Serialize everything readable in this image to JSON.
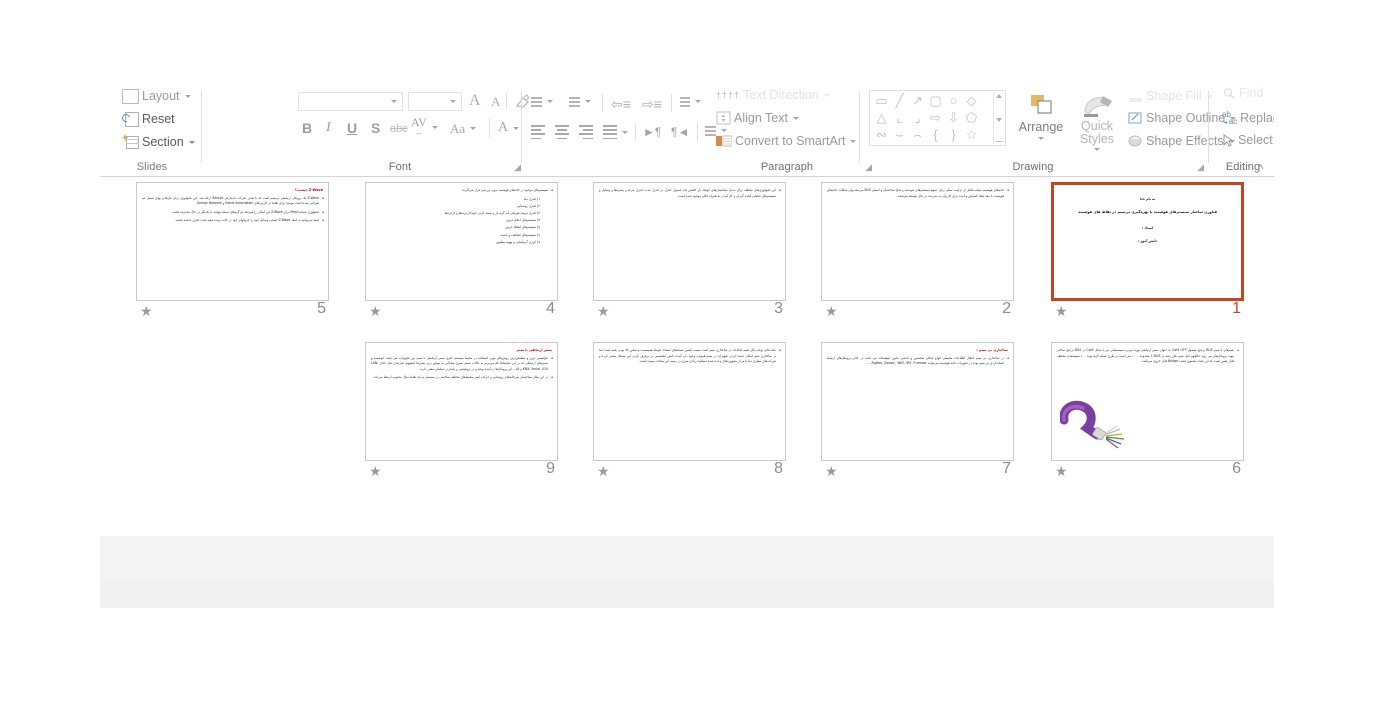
{
  "app": {
    "name": "Microsoft PowerPoint",
    "view": "Slide Sorter"
  },
  "ribbon": {
    "groups": [
      {
        "id": "slides",
        "label": "Slides"
      },
      {
        "id": "font",
        "label": "Font"
      },
      {
        "id": "paragraph",
        "label": "Paragraph"
      },
      {
        "id": "drawing",
        "label": "Drawing"
      },
      {
        "id": "editing",
        "label": "Editing"
      }
    ],
    "slides_group": {
      "label": "Slides",
      "layout_label": "Layout",
      "reset_label": "Reset",
      "section_label": "Section"
    },
    "font_group": {
      "label": "Font",
      "font_name_value": "",
      "font_size_value": "",
      "grow_font": "A",
      "shrink_font": "A",
      "clear_formatting": "clear-formatting",
      "bold": "B",
      "italic": "I",
      "underline": "U",
      "shadow": "S",
      "strikethrough": "abc",
      "character_spacing": "AV",
      "change_case": "Aa",
      "font_color": "A"
    },
    "paragraph_group": {
      "label": "Paragraph",
      "text_direction": "Text Direction",
      "align_text": "Align Text",
      "convert_to_smartart": "Convert to SmartArt"
    },
    "drawing_group": {
      "label": "Drawing",
      "arrange": "Arrange",
      "quick_styles": "Quick Styles",
      "shape_fill": "Shape Fill",
      "shape_outline": "Shape Outline",
      "shape_effects": "Shape Effects"
    },
    "editing_group": {
      "label": "Editing",
      "find": "Find",
      "replace": "Replace",
      "select": "Select"
    },
    "collapse_ribbon": "˄"
  },
  "colors": {
    "selection_border": "#c0462a",
    "heading_red": "#c00000",
    "ribbon_text": "#9a9a9a",
    "group_label": "#6e6e6e",
    "panel_band": "#f1f1f1"
  },
  "slides": [
    {
      "number": "5",
      "selected": false,
      "star": "★",
      "kind": "content",
      "heading": "Z-Wave چیست؟",
      "paragraphs": [
        "Z-Wave یک پروتکل ارتباطی بی‌سیم است که با هدف شرکت دانمارکی Zensys ارائه شد. این تکنولوژی برای نیازها و بهای بسیار کم طراحی شده است به‌ویژه برای نقاط در کاربردهای Home Automation و Sensor Network.",
        "تکنولوژی شبکه Mesh برای Z-Wave این امکان را می‌دهد دو گره‌های شبکه بتوانند با یکدیگر در حال محدوده باشند.",
        "شما می‌توانید به کمک Z-Wave کسانی وسایل خود را خریجهای خود در خانه ترتیب دهید تحت کنترل داشته باشید."
      ]
    },
    {
      "number": "4",
      "selected": false,
      "star": "★",
      "kind": "list",
      "intro": "سیستم‌های موجود در خانه‌های هوشمند مورد بررسی قرار می‌گیرند:",
      "items": [
        "۱) کنترل دما",
        "۲) کنترل روشنایی",
        "۳) کنترل تربیت فیزیکی آب گرم باز و بسته کردن خودکار پرده‌ها و کرکره‌ها",
        "۴) سیستم‌های اعلام حریق",
        "۵) سیستم‌های اطفاء حریق",
        "۶) سیستم‌های حفاظت و امنیت",
        "۷) انرژی گرمایشی و تهویه مطبوع"
      ]
    },
    {
      "number": "3",
      "selected": false,
      "star": "★",
      "kind": "content",
      "heading": "",
      "paragraphs": [
        "این تکنولوژی‌های مختلف برای تبدیل ساختمان‌های کوچک باز کاهش یابد حصول کنترل تر کنترل مدت کنترل مردم و پنجره‌ها و وسایل و سیستم‌های تعاملی آماده گردان و کار آمدن به همراه خالی موجود شده است."
      ]
    },
    {
      "number": "2",
      "selected": false,
      "star": "★",
      "kind": "content",
      "heading": "",
      "paragraphs": [
        "خانه‌های هوشمند نتیجه تکامل از ترکیب عملی برای عموم سیستم‌های سودمند و شاخ ساختمان و انسان BUS می‌دهد ولی شکلات خانه‌های هوشمند با دهه ایجاد آسایش و آمده برای کاربران به سرعت در حال توسعه می‌باشد."
      ]
    },
    {
      "number": "1",
      "selected": true,
      "star": "★",
      "kind": "title",
      "line1": "به نام خدا",
      "line2": "فناوری ساختار سیستم‌های هوشمند با بهره‌گیری بی‌سیم در نقاط های هوشمند",
      "line3": "استاد :",
      "line4": "دانش آموز :"
    },
    {
      "number": "9",
      "selected": false,
      "star": "★",
      "kind": "content",
      "heading": "بستر ارتباطی با سیم",
      "paragraphs": [
        "خواهیمی ترین و مطمئن‌ترین روش‌های مورد استفاده در محیط سیستم حاوی بستر ارتباطی با سیم بین تجهیزات می باشد خوشمند و بسترهای ارتباطی که در این محیط‌ها نام می‌بریم به حالات بستی سری میانگین به توفین برتر بسترها اینجهوم عبارتندی مثل دانای LAN، KNX، Serial، X10 و النا – این پروتکل‌ها در آینده توجه و در تروفیشی و پایدارتر عملیاتی معنی دارند.",
        "در این مکان ساختمان سرخانه‌های روشنایی و حرکت کمتر محیط‌های مختلف ساخمان در سیستم‌ به یک نقاط دنبال محبوب ارتباط می‌یابد."
      ]
    },
    {
      "number": "8",
      "selected": false,
      "star": "★",
      "kind": "content",
      "heading": "",
      "paragraphs": [
        "نکته قابل توجه دیگر نعمه امکانات در ساختاری سیم است سمت یکمین شبکه‌های امعاده خومله همینسبت و سخن بالا بودن نعمه است اما در ساختاری سیم امکان دست کردن تجهیزات در سیم همواره وجود دارد آینده دانش انجیسمی در برفرف کردن این مشکل تنشی کرده و شرکت‌های مطرح دنیا با مرکز مجهوزه‌های وعده شده سیالیت زیادی سری در زمینه این مباحث نموده است."
      ]
    },
    {
      "number": "7",
      "selected": false,
      "star": "★",
      "kind": "content",
      "heading": "ساختاری بی سیم :",
      "paragraphs": [
        "در ساختاری بی سیم انتقال اطلاعات محیطی انواع امکان سختیس و دانشی مابین کوهستاند می باشد در حالی پروتکل‌های ارتباط استانداردی بی سیم بوده در تجهیزات خانه هوشمند می‌توانند ZigBee, Zwave , WiFi, nRF, P-sensor …"
      ],
      "has_image": false
    },
    {
      "number": "6",
      "selected": false,
      "star": "★",
      "kind": "content-image",
      "heading": "",
      "paragraphs": [
        "سیم‌های با سیم BUS ترجیح معمول Cat5 UTP به عنوان بستر ارتباطی بهره می‌برد سیستماتی نیز با شکل Cat5 در BUS ترجیح ساختز نیوند پروتکل‌های می روند حالچهم قبل سیم بکار رفته در C-BUS محدوده ۱۰۰۰ متر است در طرح شبکه لازم بوده ۱۰۰ سیستمات مختلف قابل تعس است که این تعداد مجموع کشت Bridge قابل خروج می‌باشد."
      ],
      "image_name": "cat5-utp-cable-photo"
    }
  ]
}
